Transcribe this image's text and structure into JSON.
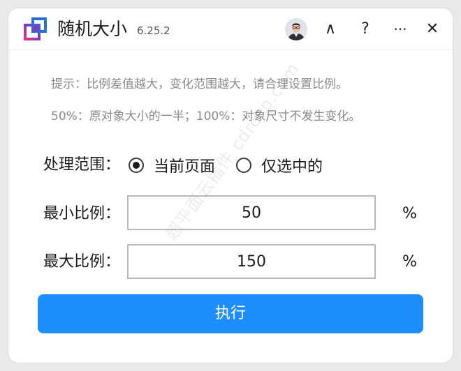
{
  "app": {
    "title": "随机大小",
    "version": "6.25.2"
  },
  "titlebar": {
    "collapse_glyph": "∧",
    "help_glyph": "?",
    "more_glyph": "···",
    "close_glyph": "✕"
  },
  "hints": [
    "提示：比例差值越大，变化范围越大，请合理设置比例。",
    "50%：原对象大小的一半；100%：对象尺寸不发生变化。"
  ],
  "scope": {
    "label": "处理范围：",
    "options": [
      {
        "label": "当前页面",
        "checked": true
      },
      {
        "label": "仅选中的",
        "checked": false
      }
    ]
  },
  "min_ratio": {
    "label": "最小比例：",
    "value": "50",
    "unit": "%"
  },
  "max_ratio": {
    "label": "最大比例：",
    "value": "150",
    "unit": "%"
  },
  "execute": {
    "label": "执行"
  },
  "watermark": "超平面云插件 cdrccp.com",
  "colors": {
    "accent": "#1e8eff",
    "logo_purple": "#7b3fb8",
    "logo_pink": "#d9388e",
    "logo_blue": "#2a6dd6"
  }
}
